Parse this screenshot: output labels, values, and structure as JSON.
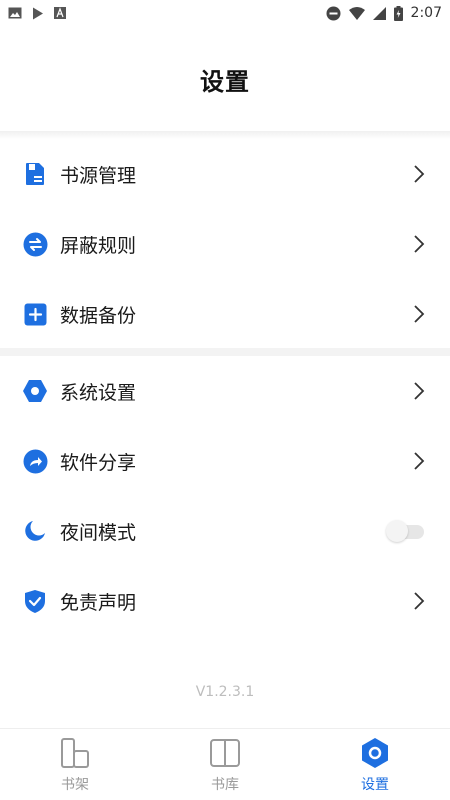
{
  "status_bar": {
    "time": "2:07",
    "left_icons": [
      "image-icon",
      "play-store-icon",
      "a-icon"
    ],
    "right_icons": [
      "dnd-icon",
      "wifi-icon",
      "signal-icon",
      "battery-icon"
    ]
  },
  "header": {
    "title": "设置"
  },
  "menu": {
    "group1": [
      {
        "label": "书源管理",
        "icon": "book-source-icon"
      },
      {
        "label": "屏蔽规则",
        "icon": "swap-icon"
      },
      {
        "label": "数据备份",
        "icon": "add-backup-icon"
      }
    ],
    "group2": [
      {
        "label": "系统设置",
        "icon": "hexagon-settings-icon"
      },
      {
        "label": "软件分享",
        "icon": "share-icon"
      },
      {
        "label": "夜间模式",
        "icon": "moon-icon",
        "toggle": false
      },
      {
        "label": "免责声明",
        "icon": "shield-check-icon"
      }
    ]
  },
  "version": "V1.2.3.1",
  "bottom_nav": {
    "items": [
      {
        "label": "书架",
        "icon": "bookshelf-icon",
        "active": false
      },
      {
        "label": "书库",
        "icon": "library-icon",
        "active": false
      },
      {
        "label": "设置",
        "icon": "settings-icon",
        "active": true
      }
    ]
  },
  "colors": {
    "accent": "#1e6fe0",
    "inactive": "#9a9a9a",
    "text": "#1a1a1a"
  }
}
